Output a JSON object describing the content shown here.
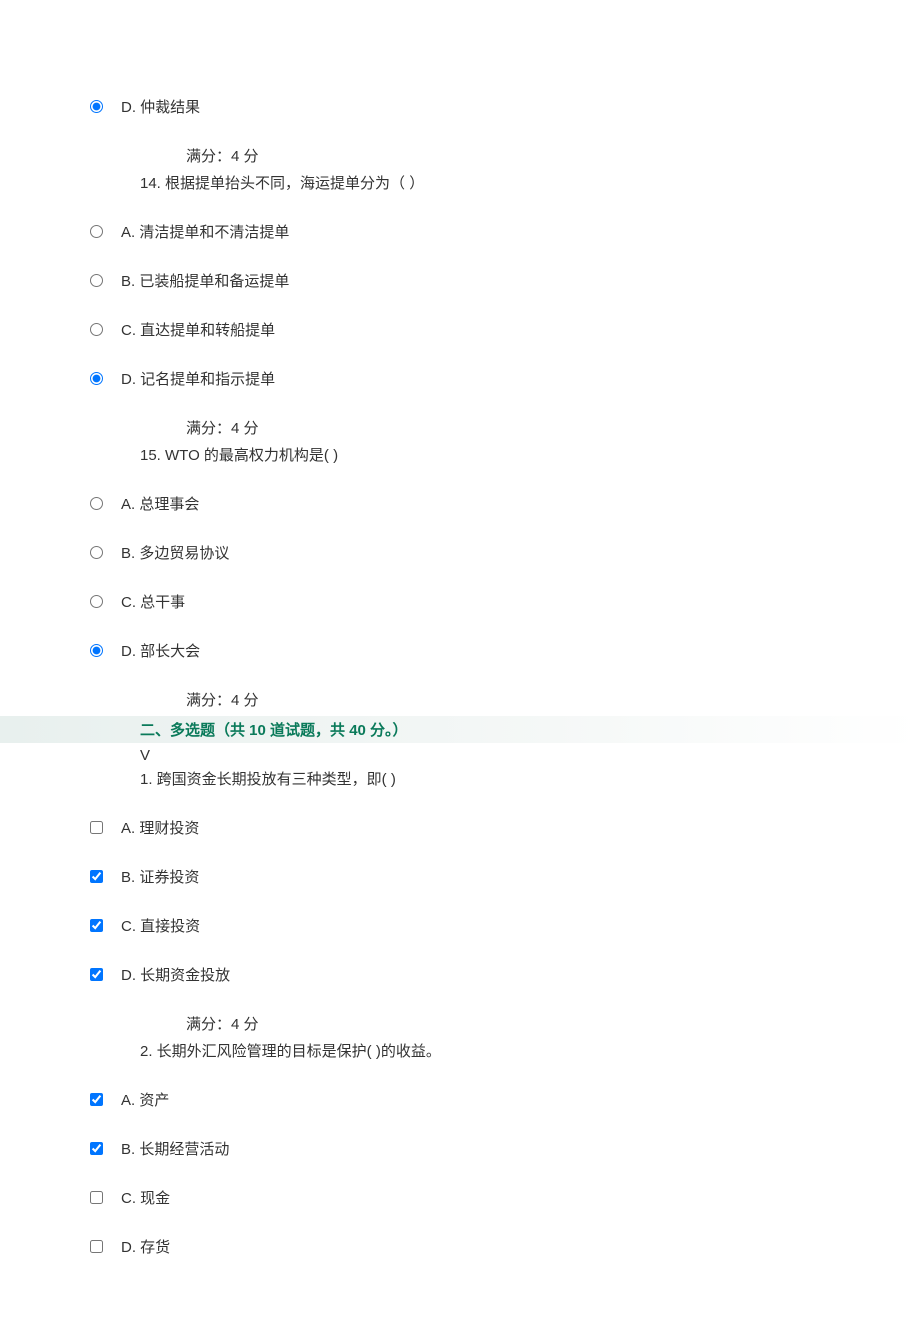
{
  "q13_prefix": {
    "optD": "D. 仲裁结果",
    "score": "满分：4 分"
  },
  "q14": {
    "text": "14. 根据提单抬头不同，海运提单分为（       ）",
    "optA": "A. 清洁提单和不清洁提单",
    "optB": "B. 已装船提单和备运提单",
    "optC": "C. 直达提单和转船提单",
    "optD": "D. 记名提单和指示提单",
    "score": "满分：4 分"
  },
  "q15": {
    "text": "15. WTO 的最高权力机构是( )",
    "optA": "A. 总理事会",
    "optB": "B. 多边贸易协议",
    "optC": "C. 总干事",
    "optD": "D. 部长大会",
    "score": "满分：4 分"
  },
  "section2": {
    "header": "二、多选题（共 10 道试题，共 40 分。）",
    "v": "V"
  },
  "mq1": {
    "text": "1. 跨国资金长期投放有三种类型，即( )",
    "optA": "A. 理财投资",
    "optB": "B. 证券投资",
    "optC": "C. 直接投资",
    "optD": "D. 长期资金投放",
    "score": "满分：4 分"
  },
  "mq2": {
    "text": "2. 长期外汇风险管理的目标是保护( )的收益。",
    "optA": "A. 资产",
    "optB": "B. 长期经营活动",
    "optC": "C. 现金",
    "optD": "D. 存货"
  }
}
